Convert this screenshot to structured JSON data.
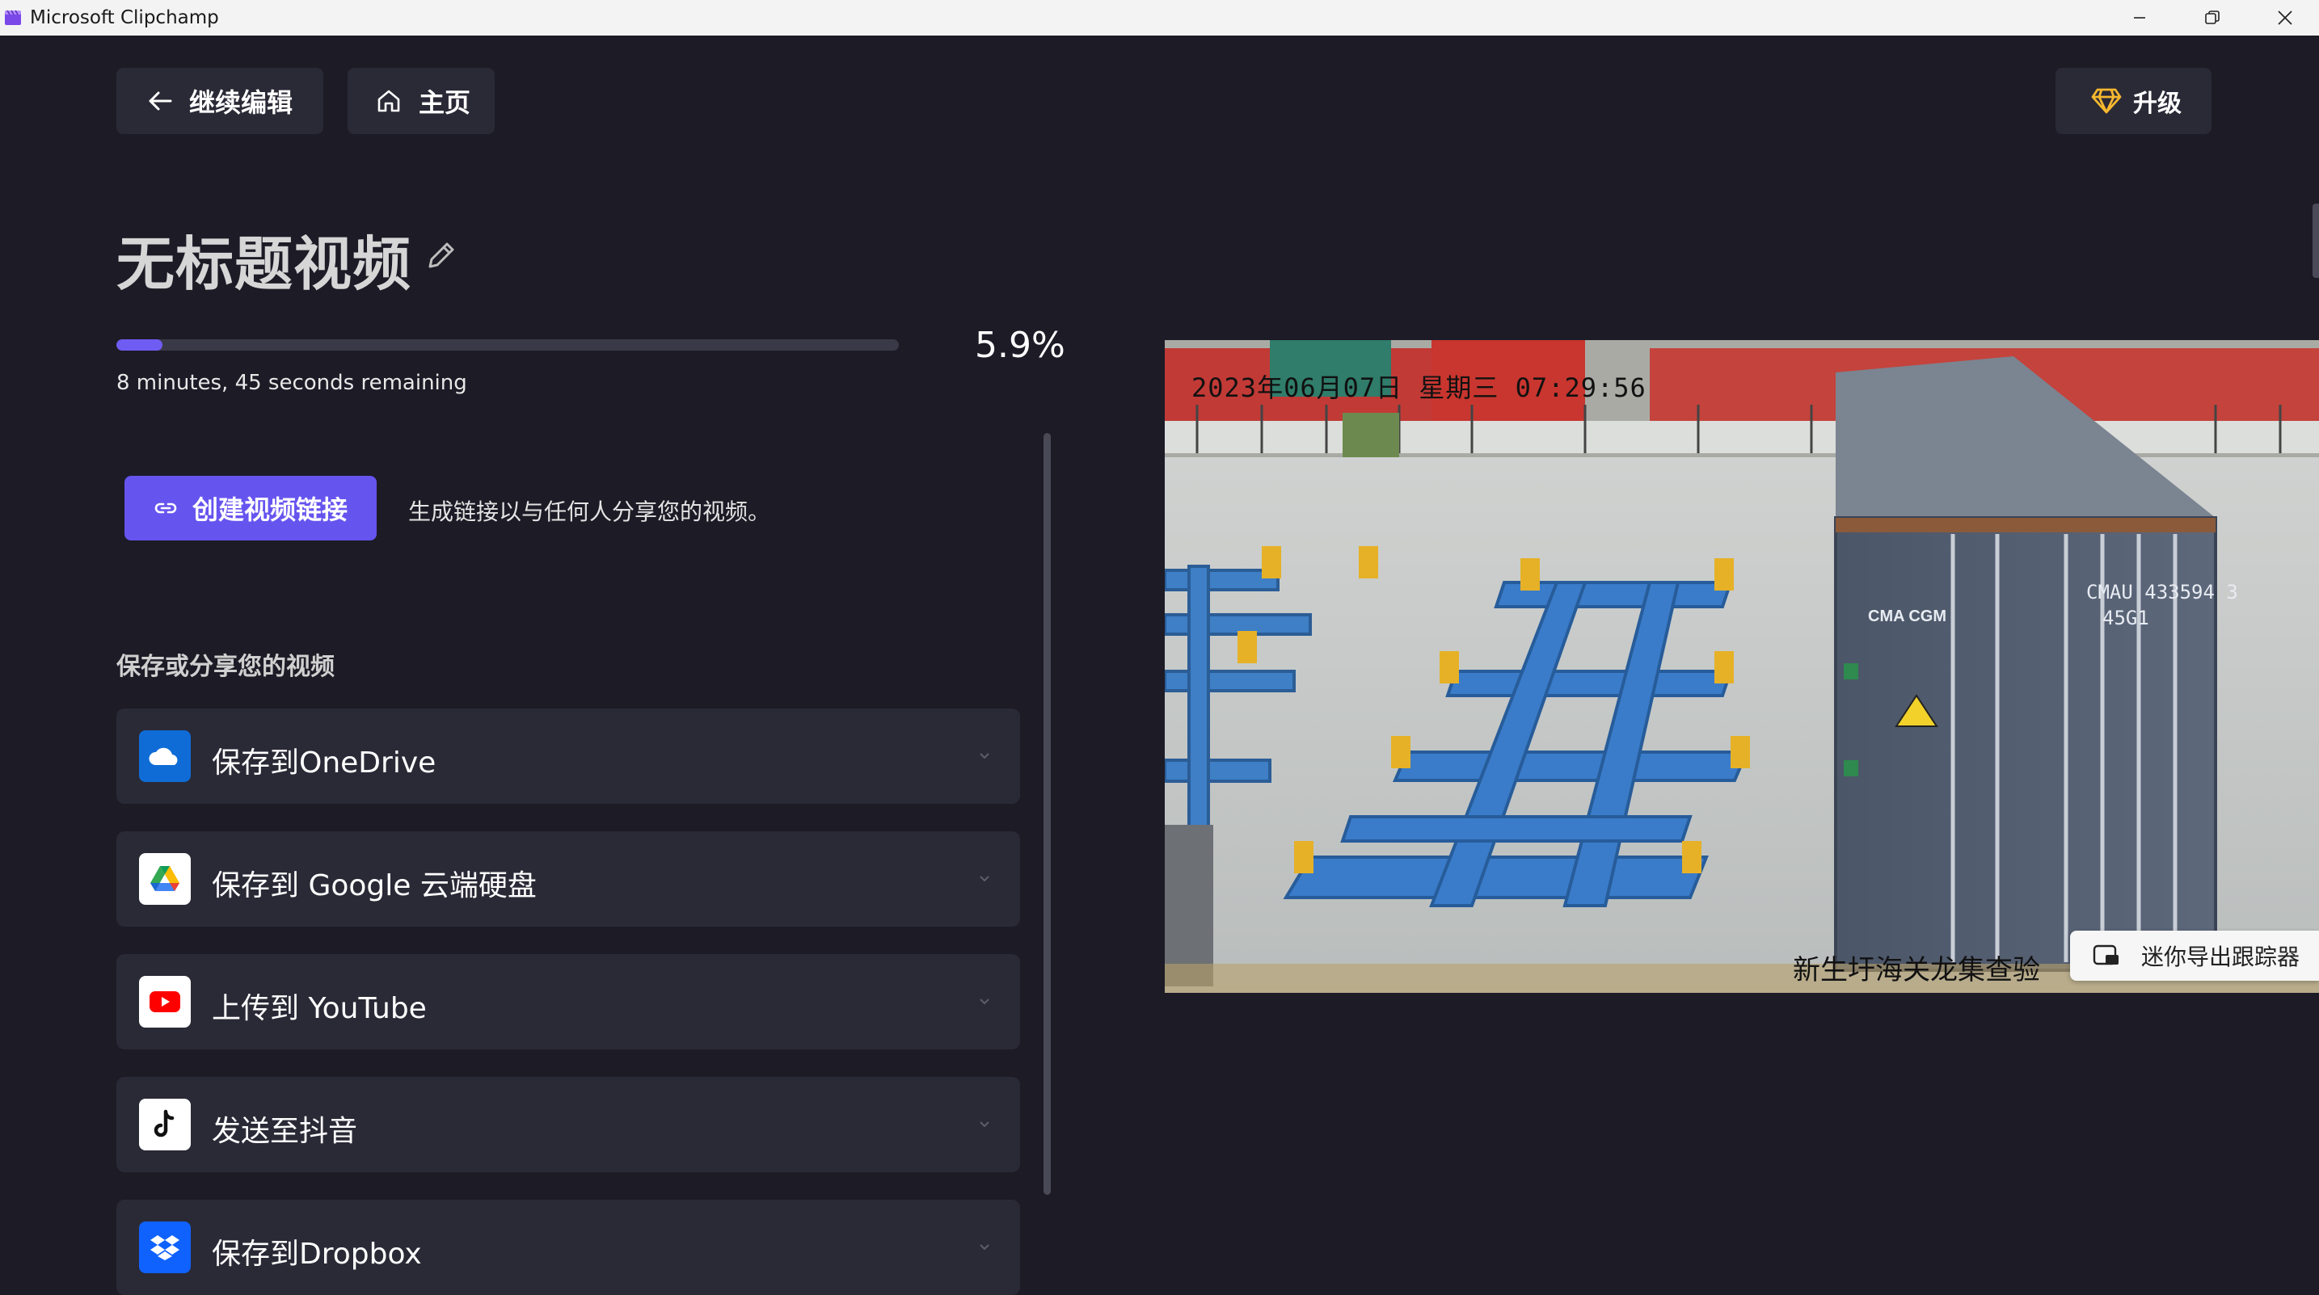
{
  "window": {
    "title": "Microsoft Clipchamp"
  },
  "toolbar": {
    "continue_label": "继续编辑",
    "home_label": "主页",
    "upgrade_label": "升级"
  },
  "video": {
    "title": "无标题视频"
  },
  "export": {
    "progress_percent": 5.9,
    "progress_label": "5.9%",
    "remaining_text": "8 minutes, 45 seconds remaining"
  },
  "link": {
    "button_label": "创建视频链接",
    "description": "生成链接以与任何人分享您的视频。"
  },
  "share": {
    "section_title": "保存或分享您的视频",
    "items": [
      {
        "label": "保存到OneDrive",
        "icon": "onedrive-icon"
      },
      {
        "label": "保存到 Google 云端硬盘",
        "icon": "google-drive-icon"
      },
      {
        "label": "上传到 YouTube",
        "icon": "youtube-icon"
      },
      {
        "label": "发送至抖音",
        "icon": "tiktok-icon"
      },
      {
        "label": "保存到Dropbox",
        "icon": "dropbox-icon"
      }
    ]
  },
  "preview": {
    "timestamp": "2023年06月07日  星期三  07:29:56",
    "caption": "新生圩海关龙集查验",
    "container_marking": "CMA CGM",
    "container_number": "CMAU 433594 3",
    "container_code": "45G1",
    "mini_tracker_label": "迷你导出跟踪器"
  },
  "colors": {
    "background": "#1c1b26",
    "surface": "#2a2936",
    "accent": "#6654ef",
    "progress": "#6f5cf2",
    "upgrade_icon": "#f5b82e"
  }
}
